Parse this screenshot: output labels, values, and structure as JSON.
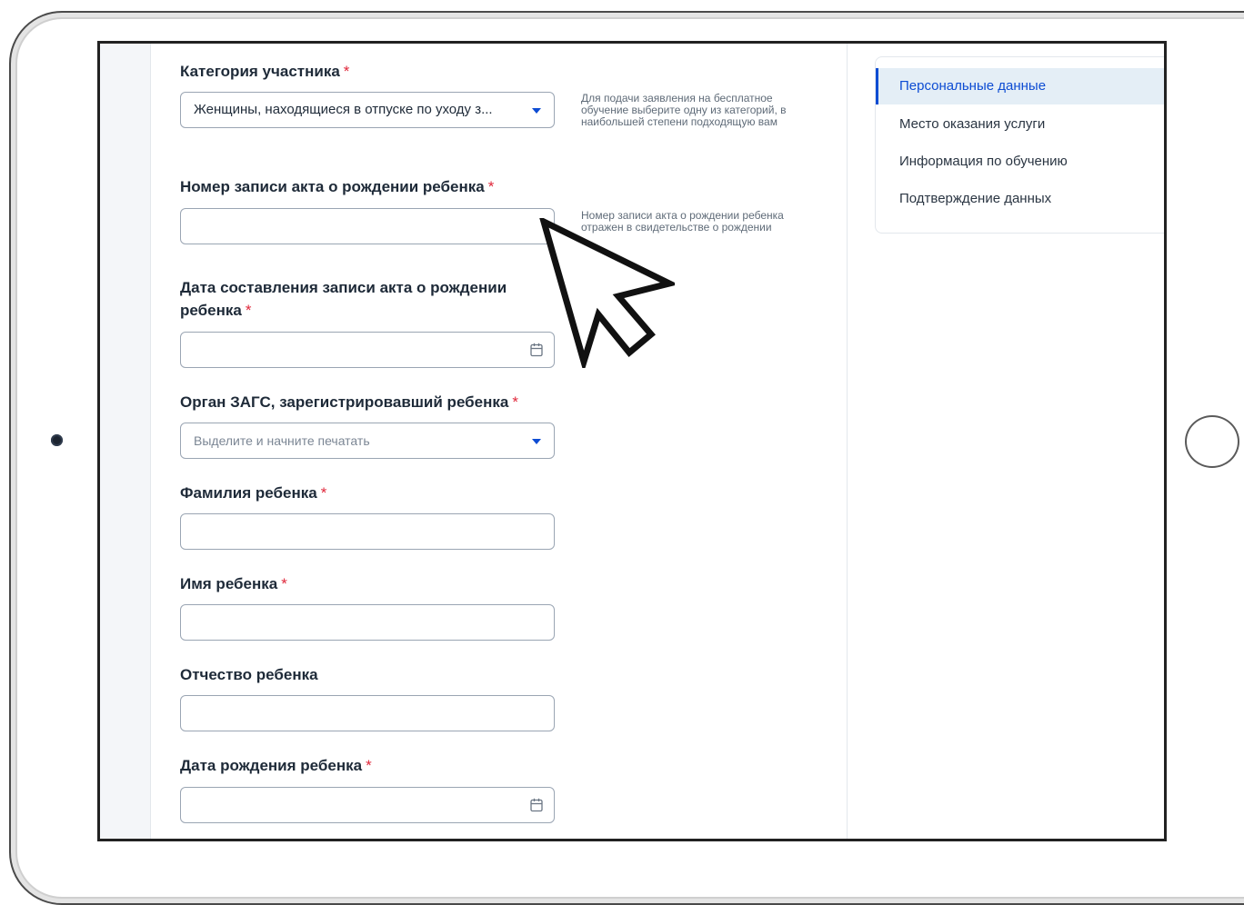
{
  "form": {
    "category": {
      "label": "Категория участника",
      "required_mark": "*",
      "value": "Женщины, находящиеся в отпуске по уходу з...",
      "hint": "Для подачи заявления на бесплатное обучение выберите одну из категорий, в наибольшей степени подходящую вам"
    },
    "birth_record_number": {
      "label": "Номер записи акта о рождении ребенка",
      "required_mark": "*",
      "value": "",
      "hint": "Номер записи акта о рождении ребенка отражен в свидетельстве о рождении"
    },
    "birth_record_date": {
      "label": "Дата составления записи акта о рождении ребенка",
      "required_mark": "*",
      "value": ""
    },
    "registry_office": {
      "label": "Орган ЗАГС, зарегистрировавший ребенка",
      "required_mark": "*",
      "placeholder": "Выделите и начните печатать"
    },
    "child_last_name": {
      "label": "Фамилия ребенка",
      "required_mark": "*",
      "value": ""
    },
    "child_first_name": {
      "label": "Имя ребенка",
      "required_mark": "*",
      "value": ""
    },
    "child_patronymic": {
      "label": "Отчество ребенка",
      "value": ""
    },
    "child_birth_date": {
      "label": "Дата рождения ребенка",
      "required_mark": "*",
      "value": ""
    }
  },
  "steps_nav": {
    "items": [
      {
        "label": "Персональные данные",
        "active": true
      },
      {
        "label": "Место оказания услуги",
        "active": false
      },
      {
        "label": "Информация по обучению",
        "active": false
      },
      {
        "label": "Подтверждение данных",
        "active": false
      }
    ]
  },
  "colors": {
    "accent": "#0d4cd3",
    "required": "#e0283b",
    "active_nav_bg": "#e4eef6"
  }
}
